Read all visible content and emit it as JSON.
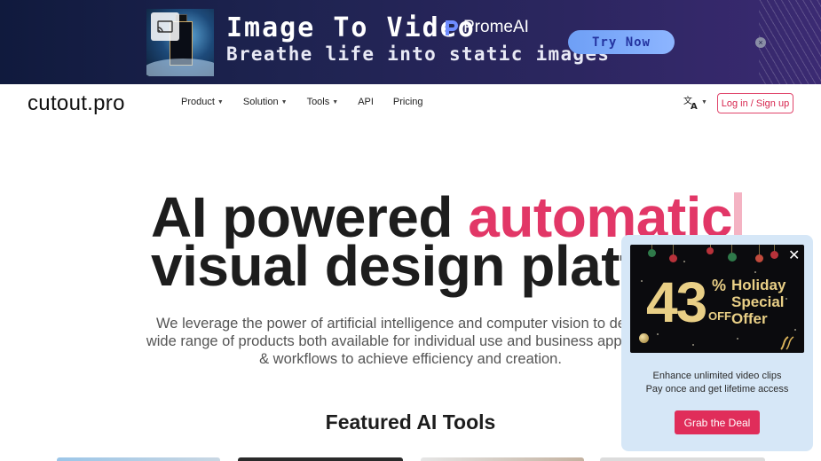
{
  "banner": {
    "title": "Image To Video",
    "subtitle": "Breathe life into static images",
    "brand": "PromeAI",
    "cta_label": "Try Now",
    "close_glyph": "×",
    "colors": {
      "cta": "#7aa8f8",
      "background": "#1e2350"
    }
  },
  "nav": {
    "logo": "cutout.pro",
    "items": [
      {
        "label": "Product",
        "has_dropdown": true
      },
      {
        "label": "Solution",
        "has_dropdown": true
      },
      {
        "label": "Tools",
        "has_dropdown": true
      },
      {
        "label": "API",
        "has_dropdown": false
      },
      {
        "label": "Pricing",
        "has_dropdown": false
      }
    ],
    "language_icon": "translate-icon",
    "login_label": "Log in / Sign up"
  },
  "hero": {
    "line1_plain": "AI powered ",
    "line1_accent": "automatic",
    "line2": "visual design platfo",
    "subtitle": "We leverage the power of artificial intelligence and computer vision to deliver a wide range of products both available for individual use and business applications & workflows to achieve efficiency and creation.",
    "accent_color": "#e23767"
  },
  "featured": {
    "heading": "Featured AI Tools"
  },
  "popup": {
    "discount_number": "43",
    "discount_symbol": "%",
    "discount_off": "OFF",
    "promo_title": "Holiday Special Offer",
    "promo_lines": [
      "Holiday",
      "Special",
      "Offer"
    ],
    "line1": "Enhance unlimited video clips",
    "line2": "Pay once and get lifetime access",
    "cta_label": "Grab the Deal",
    "close_glyph": "✕",
    "colors": {
      "cta": "#e02d5a",
      "gold": "#e9cf86",
      "panel": "#d6e7f7"
    }
  }
}
